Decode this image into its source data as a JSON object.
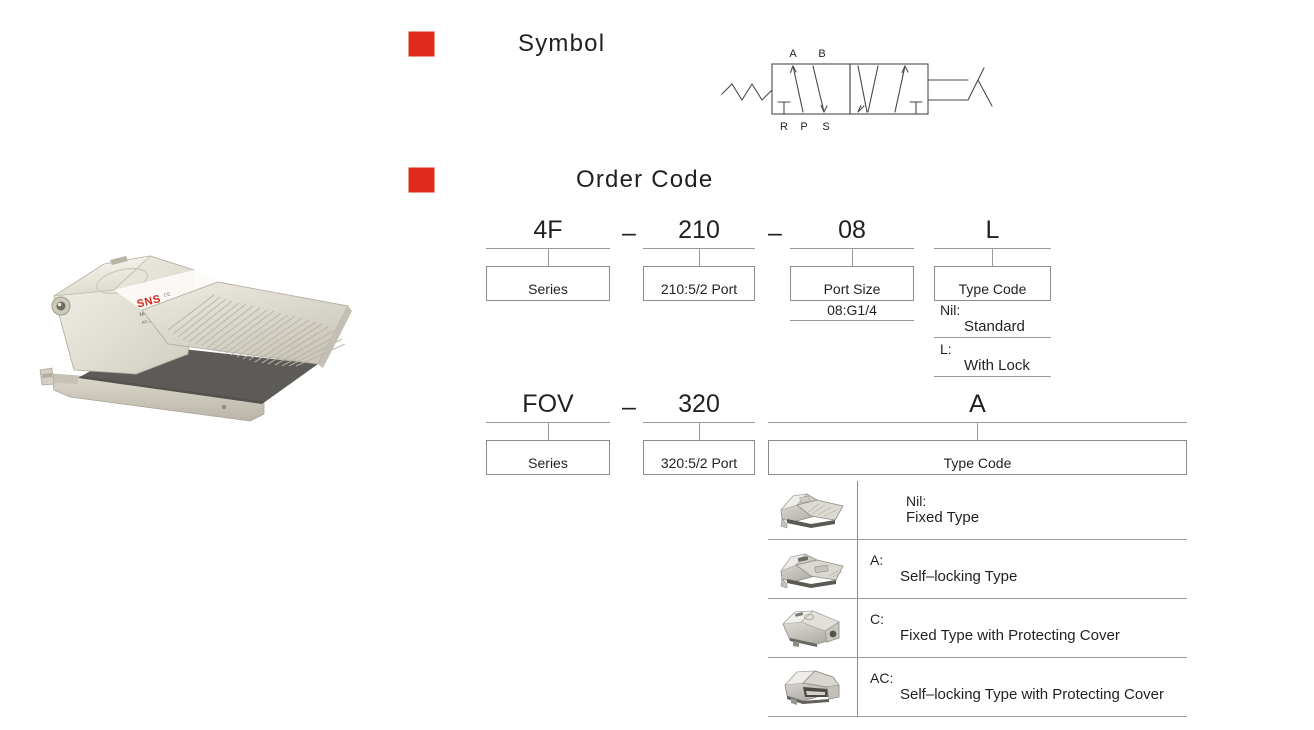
{
  "theme": {
    "bullet_color": "#e02b1c",
    "line_color": "#9a9a9a",
    "text_color": "#231f20"
  },
  "product_photo": {
    "alt": "pneumatic foot pedal valve",
    "brand_label": "SNS",
    "model_line": "MODEL:4F210",
    "spec_line": "AC 220V 50/60Hz"
  },
  "sections": [
    {
      "key": "symbol",
      "title": "Symbol"
    },
    {
      "key": "order_code",
      "title": "Order Code"
    }
  ],
  "symbol": {
    "type": "5/2 way valve",
    "port_labels_top": [
      "A",
      "B"
    ],
    "port_labels_bottom": [
      "R",
      "P",
      "S"
    ],
    "left_actuator": "spring-return",
    "right_actuator": "foot-pedal"
  },
  "order_code_rows": [
    {
      "id": "row-4f",
      "segments": [
        {
          "code": "4F",
          "box_label": "Series",
          "subs": []
        },
        {
          "code": "210",
          "box_label": "210:5/2  Port",
          "subs": []
        },
        {
          "code": "08",
          "box_label": "Port Size",
          "subs": [
            "08:G1/4"
          ]
        },
        {
          "code": "L",
          "box_label": "Type Code",
          "options": [
            {
              "key": "Nil:",
              "value": "Standard"
            },
            {
              "key": "L:",
              "value": "With Lock"
            }
          ]
        }
      ],
      "separators": [
        "–",
        "–"
      ]
    },
    {
      "id": "row-fov",
      "segments": [
        {
          "code": "FOV",
          "box_label": "Series",
          "subs": []
        },
        {
          "code": "320",
          "box_label": "320:5/2  Port",
          "subs": []
        },
        {
          "code": "A",
          "box_label": "Type Code",
          "subs": []
        }
      ],
      "separators": [
        "–"
      ]
    }
  ],
  "type_code_table": {
    "rows": [
      {
        "code": "Nil:",
        "desc": "Fixed Type",
        "image": "pedal-fixed-icon",
        "indent": "wide"
      },
      {
        "code": "A:",
        "desc": "Self–locking Type",
        "image": "pedal-selflock-icon",
        "indent": "narrow"
      },
      {
        "code": "C:",
        "desc": "Fixed Type with Protecting Cover",
        "image": "pedal-cover-icon",
        "indent": "narrow"
      },
      {
        "code": "AC:",
        "desc": "Self–locking Type with Protecting Cover",
        "image": "pedal-selflock-cover-icon",
        "indent": "narrow"
      }
    ]
  }
}
